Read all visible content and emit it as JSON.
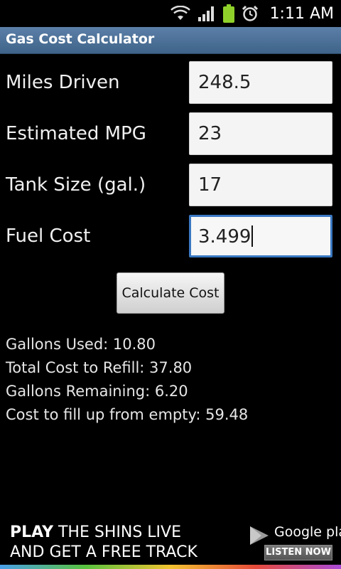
{
  "status_bar": {
    "time": "1:11 AM",
    "icons": [
      "wifi-icon",
      "signal-icon",
      "battery-icon",
      "alarm-icon"
    ]
  },
  "app": {
    "title": "Gas Cost Calculator"
  },
  "form": {
    "fields": [
      {
        "label": "Miles Driven",
        "value": "248.5"
      },
      {
        "label": "Estimated MPG",
        "value": "23"
      },
      {
        "label": "Tank Size (gal.)",
        "value": "17"
      },
      {
        "label": "Fuel Cost",
        "value": "3.499"
      }
    ],
    "calculate_label": "Calculate Cost"
  },
  "results": [
    "Gallons Used: 10.80",
    "Total Cost to Refill: 37.80",
    "Gallons Remaining: 6.20",
    "Cost to fill up from empty: 59.48"
  ],
  "ad": {
    "line1_bold": "PLAY",
    "line1_rest": " THE SHINS LIVE",
    "line2": "AND GET A FREE TRACK",
    "store_name": "Google play",
    "cta": "LISTEN NOW"
  },
  "colors": {
    "title_bar": "#4a6f97",
    "focus_border": "#3a78c2",
    "background": "#000000"
  }
}
